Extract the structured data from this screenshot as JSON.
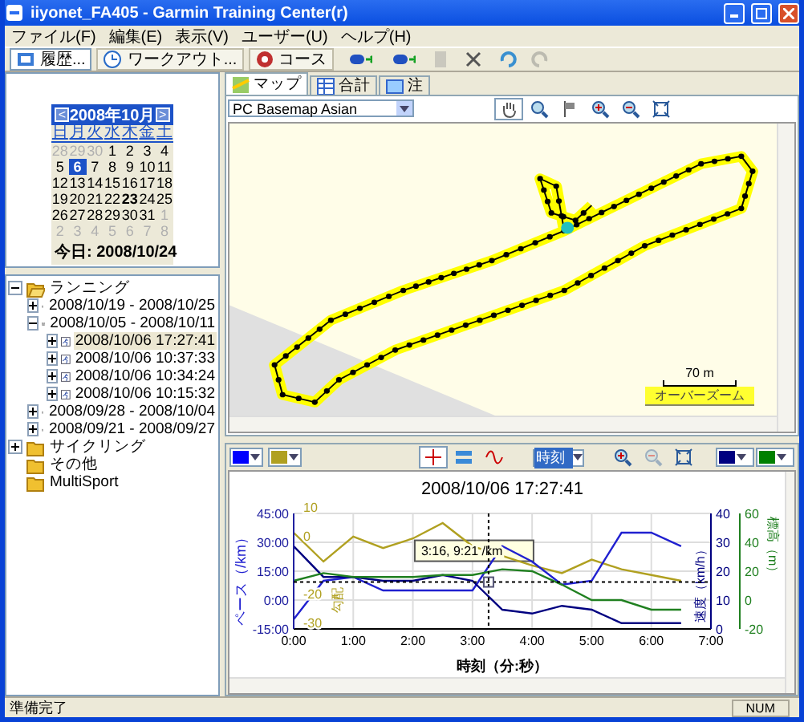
{
  "window": {
    "title": "iiyonet_FA405 - Garmin Training Center(r)"
  },
  "menu": [
    "ファイル(F)",
    "編集(E)",
    "表示(V)",
    "ユーザー(U)",
    "ヘルプ(H)"
  ],
  "toolbar": {
    "views": [
      {
        "label": "履歴...",
        "kind": "history",
        "selected": true
      },
      {
        "label": "ワークアウト...",
        "kind": "workout",
        "selected": false
      },
      {
        "label": "コース",
        "kind": "course",
        "selected": false
      }
    ],
    "tools": [
      {
        "kind": "receive",
        "disabled": false
      },
      {
        "kind": "send",
        "disabled": false
      },
      {
        "kind": "page",
        "disabled": true
      },
      {
        "kind": "delete",
        "disabled": false
      },
      {
        "kind": "undo",
        "disabled": false
      },
      {
        "kind": "redo",
        "disabled": true
      }
    ]
  },
  "calendar": {
    "month": "2008年10月",
    "prev": "<",
    "next": ">",
    "weekdays": [
      "日",
      "月",
      "火",
      "水",
      "木",
      "金",
      "土"
    ],
    "days": [
      {
        "label": "28",
        "muted": true,
        "selected": false,
        "bold": false
      },
      {
        "label": "29",
        "muted": true,
        "selected": false,
        "bold": false
      },
      {
        "label": "30",
        "muted": true,
        "selected": false,
        "bold": false
      },
      {
        "label": "1",
        "muted": false,
        "selected": false,
        "bold": false
      },
      {
        "label": "2",
        "muted": false,
        "selected": false,
        "bold": false
      },
      {
        "label": "3",
        "muted": false,
        "selected": false,
        "bold": false
      },
      {
        "label": "4",
        "muted": false,
        "selected": false,
        "bold": false
      },
      {
        "label": "5",
        "muted": false,
        "selected": false,
        "bold": false
      },
      {
        "label": "6",
        "muted": false,
        "selected": true,
        "bold": false
      },
      {
        "label": "7",
        "muted": false,
        "selected": false,
        "bold": false
      },
      {
        "label": "8",
        "muted": false,
        "selected": false,
        "bold": false
      },
      {
        "label": "9",
        "muted": false,
        "selected": false,
        "bold": false
      },
      {
        "label": "10",
        "muted": false,
        "selected": false,
        "bold": false
      },
      {
        "label": "11",
        "muted": false,
        "selected": false,
        "bold": false
      },
      {
        "label": "12",
        "muted": false,
        "selected": false,
        "bold": false
      },
      {
        "label": "13",
        "muted": false,
        "selected": false,
        "bold": false
      },
      {
        "label": "14",
        "muted": false,
        "selected": false,
        "bold": false
      },
      {
        "label": "15",
        "muted": false,
        "selected": false,
        "bold": false
      },
      {
        "label": "16",
        "muted": false,
        "selected": false,
        "bold": false
      },
      {
        "label": "17",
        "muted": false,
        "selected": false,
        "bold": false
      },
      {
        "label": "18",
        "muted": false,
        "selected": false,
        "bold": false
      },
      {
        "label": "19",
        "muted": false,
        "selected": false,
        "bold": false
      },
      {
        "label": "20",
        "muted": false,
        "selected": false,
        "bold": false
      },
      {
        "label": "21",
        "muted": false,
        "selected": false,
        "bold": false
      },
      {
        "label": "22",
        "muted": false,
        "selected": false,
        "bold": false
      },
      {
        "label": "23",
        "muted": false,
        "selected": false,
        "bold": true
      },
      {
        "label": "24",
        "muted": false,
        "selected": false,
        "bold": false
      },
      {
        "label": "25",
        "muted": false,
        "selected": false,
        "bold": false
      },
      {
        "label": "26",
        "muted": false,
        "selected": false,
        "bold": false
      },
      {
        "label": "27",
        "muted": false,
        "selected": false,
        "bold": false
      },
      {
        "label": "28",
        "muted": false,
        "selected": false,
        "bold": false
      },
      {
        "label": "29",
        "muted": false,
        "selected": false,
        "bold": false
      },
      {
        "label": "30",
        "muted": false,
        "selected": false,
        "bold": false
      },
      {
        "label": "31",
        "muted": false,
        "selected": false,
        "bold": false
      },
      {
        "label": "1",
        "muted": true,
        "selected": false,
        "bold": false
      },
      {
        "label": "2",
        "muted": true,
        "selected": false,
        "bold": false
      },
      {
        "label": "3",
        "muted": true,
        "selected": false,
        "bold": false
      },
      {
        "label": "4",
        "muted": true,
        "selected": false,
        "bold": false
      },
      {
        "label": "5",
        "muted": true,
        "selected": false,
        "bold": false
      },
      {
        "label": "6",
        "muted": true,
        "selected": false,
        "bold": false
      },
      {
        "label": "7",
        "muted": true,
        "selected": false,
        "bold": false
      },
      {
        "label": "8",
        "muted": true,
        "selected": false,
        "bold": false
      }
    ],
    "today": "今日: 2008/10/24"
  },
  "tree": [
    {
      "label": "ランニング",
      "kind": "folder",
      "expandable": true,
      "expanded": true,
      "selected": false,
      "children": [
        {
          "label": "2008/10/19 - 2008/10/25",
          "kind": "week",
          "expandable": true,
          "expanded": false,
          "selected": false
        },
        {
          "label": "2008/10/05 - 2008/10/11",
          "kind": "week",
          "expandable": true,
          "expanded": true,
          "selected": false,
          "children": [
            {
              "label": "2008/10/06 17:27:41",
              "kind": "activity",
              "expandable": true,
              "expanded": false,
              "selected": true
            },
            {
              "label": "2008/10/06 10:37:33",
              "kind": "activity",
              "expandable": true,
              "expanded": false,
              "selected": false
            },
            {
              "label": "2008/10/06 10:34:24",
              "kind": "activity",
              "expandable": true,
              "expanded": false,
              "selected": false
            },
            {
              "label": "2008/10/06 10:15:32",
              "kind": "activity",
              "expandable": true,
              "expanded": false,
              "selected": false
            }
          ]
        },
        {
          "label": "2008/09/28 - 2008/10/04",
          "kind": "week",
          "expandable": true,
          "expanded": false,
          "selected": false
        },
        {
          "label": "2008/09/21 - 2008/09/27",
          "kind": "week",
          "expandable": true,
          "expanded": false,
          "selected": false
        }
      ]
    },
    {
      "label": "サイクリング",
      "kind": "folder",
      "expandable": true,
      "expanded": false,
      "selected": false
    },
    {
      "label": "その他",
      "kind": "folder",
      "expandable": false,
      "expanded": false,
      "selected": false
    },
    {
      "label": "MultiSport",
      "kind": "folder",
      "expandable": false,
      "expanded": false,
      "selected": false
    }
  ],
  "map_tabs": [
    {
      "label": "マップ",
      "kind": "map",
      "selected": true
    },
    {
      "label": "合計",
      "kind": "table",
      "selected": false
    },
    {
      "label": "注",
      "kind": "note",
      "selected": false
    }
  ],
  "map": {
    "basemap": "PC Basemap Asian",
    "tools": [
      {
        "kind": "hand",
        "selected": true
      },
      {
        "kind": "search",
        "selected": false
      },
      {
        "kind": "flag",
        "selected": false
      },
      {
        "kind": "zoom_in",
        "selected": false
      },
      {
        "kind": "zoom_out",
        "selected": false
      },
      {
        "kind": "fit",
        "selected": false
      }
    ],
    "scale": "70 m",
    "overzoom": "オーバーズーム"
  },
  "chart_toolbar": {
    "left_colors": [
      {
        "color": "#0000ff"
      },
      {
        "color": "#b0a020"
      }
    ],
    "tools": [
      {
        "kind": "crosshair",
        "selected": true
      },
      {
        "kind": "band",
        "selected": false
      },
      {
        "kind": "curve",
        "selected": false
      }
    ],
    "x_mode": "時刻",
    "zoom_tools": [
      {
        "kind": "zoom_in",
        "disabled": false
      },
      {
        "kind": "zoom_out",
        "disabled": true
      },
      {
        "kind": "fit",
        "disabled": false
      }
    ],
    "right_colors": [
      {
        "color": "#000080"
      },
      {
        "color": "#008000"
      }
    ]
  },
  "chart": {
    "chart_data": {
      "type": "line",
      "title": "2008/10/06 17:27:41",
      "xlabel": "時刻（分:秒）",
      "grid": true,
      "x": [
        0,
        0.5,
        1,
        1.5,
        2,
        2.5,
        3,
        3.5,
        4,
        4.5,
        5,
        5.5,
        6,
        6.5
      ],
      "xticks": [
        {
          "value": 0,
          "label": "0:00"
        },
        {
          "value": 1,
          "label": "1:00"
        },
        {
          "value": 2,
          "label": "2:00"
        },
        {
          "value": 3,
          "label": "3:00"
        },
        {
          "value": 4,
          "label": "4:00"
        },
        {
          "value": 5,
          "label": "5:00"
        },
        {
          "value": 6,
          "label": "6:00"
        },
        {
          "value": 7,
          "label": "7:00"
        }
      ],
      "ylim": [
        -15,
        45
      ],
      "xlim": [
        0,
        7
      ],
      "yticks": [
        {
          "value": 45,
          "label": "45:00"
        },
        {
          "value": 30,
          "label": "30:00"
        },
        {
          "value": 15,
          "label": "15:00"
        },
        {
          "value": 0,
          "label": "0:00"
        },
        {
          "value": -15,
          "label": "-15:00"
        }
      ],
      "series": [
        {
          "name": "勾配",
          "color": "#b0a020",
          "values": [
            35,
            20,
            33,
            27,
            32,
            40,
            28,
            23,
            18,
            14,
            21,
            16,
            13,
            10
          ]
        },
        {
          "name": "ペース（/km）",
          "color": "#2020d0",
          "values": [
            -10,
            10,
            12,
            5,
            5,
            5,
            5,
            28,
            20,
            8,
            10,
            35,
            35,
            28
          ]
        },
        {
          "name": "速度（km/h）",
          "color": "#000080",
          "values": [
            28,
            12,
            12,
            10,
            10,
            13,
            10,
            -5,
            -7,
            -3,
            -5,
            -12,
            -12,
            -12
          ]
        },
        {
          "name": "標高（m）",
          "color": "#208020",
          "values": [
            10,
            14,
            12,
            12,
            12,
            13,
            13,
            16,
            15,
            8,
            0,
            0,
            -5,
            -5
          ]
        }
      ],
      "ref_lines": [
        {
          "axis": "x",
          "value": 3.27
        },
        {
          "axis": "y",
          "value": 9.35
        }
      ],
      "annotations": [
        {
          "x": 3.27,
          "y": 9.35,
          "text": "3:16, 9:21 /km"
        }
      ]
    },
    "grade_ticks": [
      "10",
      "0",
      "-20",
      "-30"
    ],
    "speed_ticks": [
      "40",
      "30",
      "20",
      "10",
      "0"
    ],
    "elevation_ticks": [
      "60",
      "40",
      "20",
      "0",
      "-20"
    ]
  },
  "status_bar": {
    "message": "準備完了",
    "num": "NUM"
  }
}
